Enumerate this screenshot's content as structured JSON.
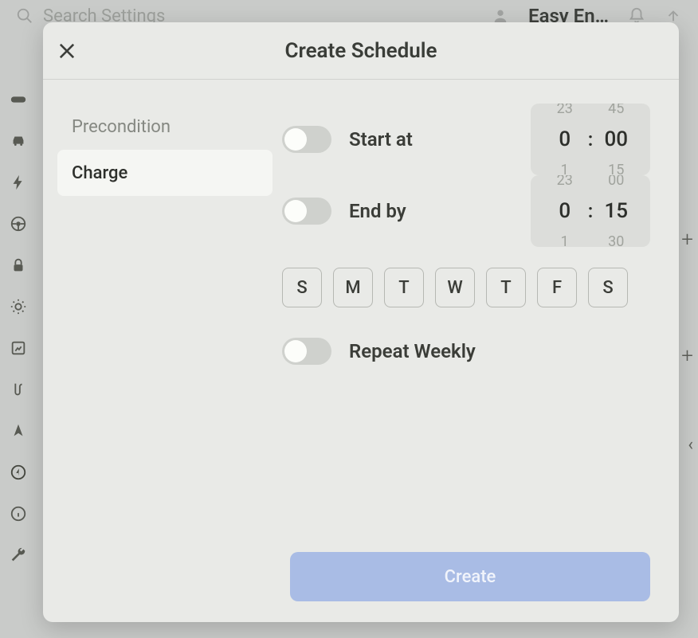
{
  "topbar": {
    "search_placeholder": "Search Settings",
    "user_label": "Easy En…"
  },
  "modal": {
    "title": "Create Schedule",
    "close_label": "Close",
    "tabs": {
      "precondition": "Precondition",
      "charge": "Charge"
    },
    "start": {
      "label": "Start at",
      "hour": "0",
      "minute": "00",
      "hour_prev": "23",
      "hour_next": "1",
      "minute_prev": "45",
      "minute_next": "15"
    },
    "end": {
      "label": "End by",
      "hour": "0",
      "minute": "15",
      "hour_prev": "23",
      "hour_next": "1",
      "minute_prev": "00",
      "minute_next": "30"
    },
    "days": [
      "S",
      "M",
      "T",
      "W",
      "T",
      "F",
      "S"
    ],
    "repeat_label": "Repeat Weekly",
    "create_label": "Create"
  },
  "state": {
    "active_tab": "charge",
    "start_enabled": false,
    "end_enabled": false,
    "repeat_weekly": false,
    "selected_days": []
  },
  "colors": {
    "modal_bg": "#e9eae7",
    "accent": "#a9bce5",
    "text": "#3b3d38"
  }
}
